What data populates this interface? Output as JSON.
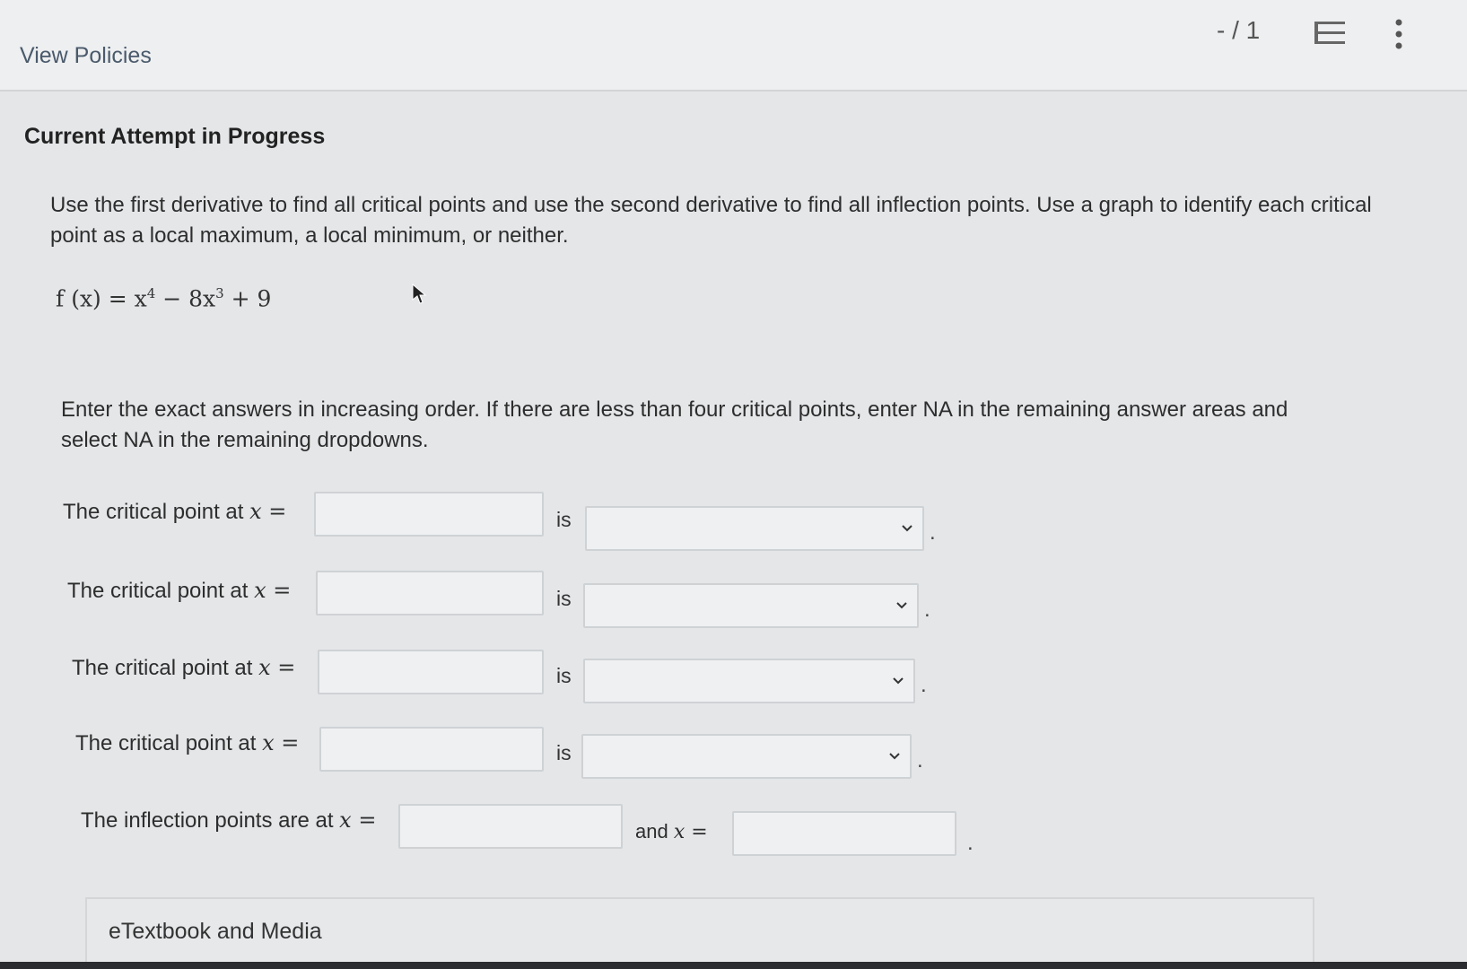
{
  "header": {
    "view_policies": "View Policies",
    "score": "- / 1",
    "icons": [
      "list-icon",
      "more-vertical-icon"
    ]
  },
  "question": {
    "attempt_title": "Current Attempt in Progress",
    "instructions": "Use the first derivative to find all critical points and use the second derivative to find all inflection points. Use a graph to identify each critical point as a local maximum, a local minimum, or neither.",
    "function": {
      "lhs": "f (x) = x",
      "exp1": "4",
      "mid": " − 8x",
      "exp2": "3",
      "rhs": " + 9"
    },
    "enter_text": "Enter the exact answers in increasing order. If there are less than four critical points, enter NA in the remaining answer areas and select NA in the remaining dropdowns."
  },
  "critical_points": [
    {
      "label": "The critical point at ",
      "var": "x",
      "eq": " =",
      "value": "",
      "is": "is",
      "selected": "",
      "end": "."
    },
    {
      "label": "The critical point at ",
      "var": "x",
      "eq": " =",
      "value": "",
      "is": "is",
      "selected": "",
      "end": "."
    },
    {
      "label": "The critical point at ",
      "var": "x",
      "eq": " =",
      "value": "",
      "is": "is",
      "selected": "",
      "end": "."
    },
    {
      "label": "The critical point at ",
      "var": "x",
      "eq": " =",
      "value": "",
      "is": "is",
      "selected": "",
      "end": "."
    }
  ],
  "inflection": {
    "label": "The inflection points are at ",
    "var": "x",
    "eq": " =",
    "value1": "",
    "and": "and ",
    "var2": "x",
    "eq2": " =",
    "value2": "",
    "end": "."
  },
  "footer": {
    "etextbook": "eTextbook and Media"
  },
  "colors": {
    "background": "#e4e6e8",
    "input_border": "#cfd2d5",
    "link": "#4a5a6c"
  }
}
